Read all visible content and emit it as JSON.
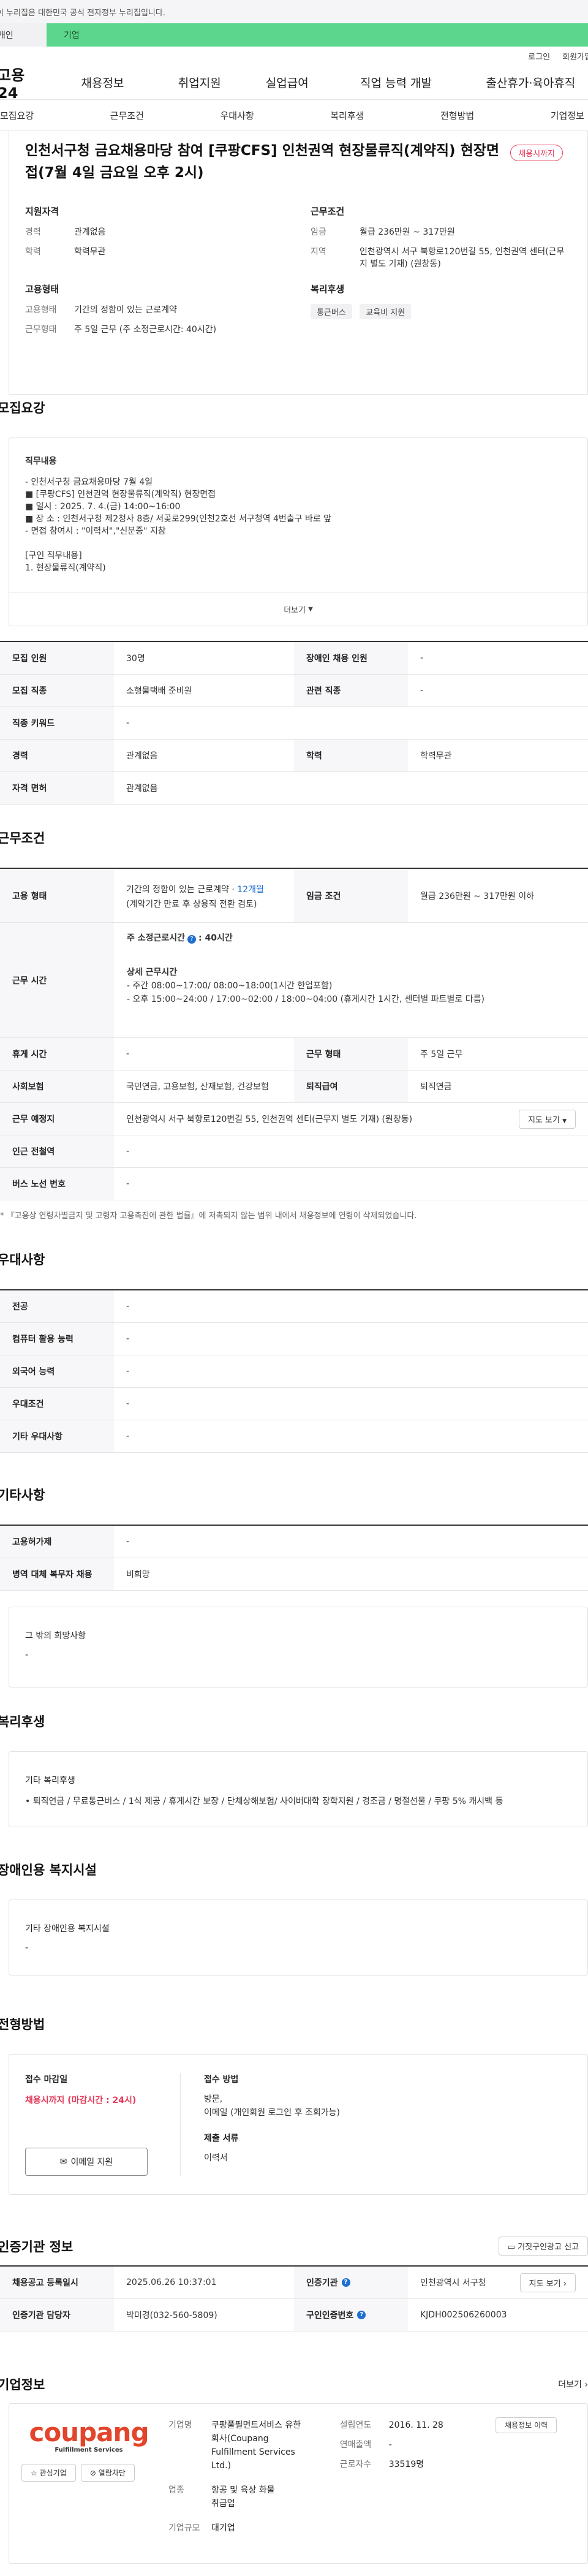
{
  "topbar": {
    "notice": "이 누리집은 대한민국 공식 전자정부 누리집입니다."
  },
  "site_tabs": {
    "personal": "개인",
    "enterprise": "기업"
  },
  "util": {
    "login": "로그인",
    "join": "회원가입"
  },
  "gnb": {
    "logo": "고용24",
    "menus": [
      "채용정보",
      "취업지원",
      "실업급여",
      "직업 능력 개발",
      "출산휴가·육아휴직"
    ]
  },
  "subnav": [
    "모집요강",
    "근무조건",
    "우대사항",
    "복리후생",
    "전형방법",
    "기업정보"
  ],
  "header": {
    "title": "인천서구청 금요채용마당 참여 [쿠팡CFS] 인천권역 현장물류직(계약직) 현장면접(7월 4일 금요일 오후 2시)",
    "badge": "채용시까지",
    "left_heading": "지원자격",
    "left": [
      {
        "k": "경력",
        "v": "관계없음"
      },
      {
        "k": "학력",
        "v": "학력무관"
      }
    ],
    "right_heading": "근무조건",
    "right": [
      {
        "k": "임금",
        "v": "월급 236만원 ~ 317만원"
      },
      {
        "k": "지역",
        "v": "인천광역시 서구 북항로120번길 55, 인천권역 센터(근무지 별도 기재) (원창동)"
      }
    ],
    "emp_heading": "고용형태",
    "emp": [
      {
        "k": "고용형태",
        "v": "기간의 정함이 있는 근로계약"
      },
      {
        "k": "근무형태",
        "v": "주 5일 근무 (주 소정근로시간: 40시간)"
      }
    ],
    "welfare_heading": "복리후생",
    "welfare": [
      "통근버스",
      "교육비 지원"
    ]
  },
  "recruit": {
    "title": "모집요강",
    "content_label": "직무내용",
    "lines": [
      "- 인천서구청 금요채용마당 7월 4일",
      "■ [쿠팡CFS] 인천권역 현장물류직(계약직) 현장면접",
      "■ 일시 : 2025. 7. 4.(금) 14:00~16:00",
      "■ 장 소 : 인천서구청 제2청사 8층/ 서곶로299(인천2호선 서구청역 4번출구 바로 앞",
      "- 면접 참여시 : \"이력서\",\"신분증\" 지참",
      "",
      "[구인 직무내용]",
      "1. 현장물류직(계약직)"
    ],
    "more": "더보기",
    "rows": [
      [
        {
          "k": "모집 인원",
          "v": "30명"
        },
        {
          "k": "장애인 채용 인원",
          "v": "-"
        }
      ],
      [
        {
          "k": "모집 직종",
          "v": "소형물택배 준비원"
        },
        {
          "k": "관련 직종",
          "v": "-"
        }
      ],
      [
        {
          "k": "직종 키워드",
          "v": "-"
        }
      ],
      [
        {
          "k": "경력",
          "v": "관계없음"
        },
        {
          "k": "학력",
          "v": "학력무관"
        }
      ],
      [
        {
          "k": "자격 면허",
          "v": "관계없음"
        }
      ]
    ]
  },
  "work": {
    "title": "근무조건",
    "emp_k": "고용 형태",
    "emp_v1": "기간의 정함이 있는 근로계약 · ",
    "emp_link": "12개월",
    "emp_v2": "(계약기간 만료 후 상용직 전환 검토)",
    "wage_k": "임금 조건",
    "wage_v": "월급 236만원 ~ 317만원 이하",
    "time_k": "근무 시간",
    "time_head": "주 소정근로시간",
    "time_hours": ": 40시간",
    "time_detail_head": "상세 근무시간",
    "time_lines": [
      "- 주간 08:00~17:00/ 08:00~18:00(1시간 한업포함)",
      "- 오후 15:00~24:00 / 17:00~02:00 / 18:00~04:00 (휴게시간 1시간, 센터별 파트별로 다름)"
    ],
    "rest_k": "휴게 시간",
    "rest_v": "-",
    "form_k": "근무 형태",
    "form_v": "주 5일 근무",
    "ins_k": "사회보험",
    "ins_v": "국민연금, 고용보험, 산재보험, 건강보험",
    "ret_k": "퇴직급여",
    "ret_v": "퇴직연금",
    "place_k": "근무 예정지",
    "place_v": "인천광역시 서구 북항로120번길 55, 인천권역 센터(근무지 별도 기재) (원창동)",
    "map_btn": "지도 보기",
    "sub_k": "인근 전철역",
    "sub_v": "-",
    "bus_k": "버스 노선 번호",
    "bus_v": "-",
    "note": "* 『고용상 연령차별금지 및 고령자 고용촉진에 관한 법률』에 저촉되지 않는 범위 내에서 채용정보에 연령이 삭제되었습니다."
  },
  "pref": {
    "title": "우대사항",
    "rows": [
      {
        "k": "전공",
        "v": "-"
      },
      {
        "k": "컴퓨터 활용 능력",
        "v": "-"
      },
      {
        "k": "외국어 능력",
        "v": "-"
      },
      {
        "k": "우대조건",
        "v": "-"
      },
      {
        "k": "기타 우대사항",
        "v": "-"
      }
    ]
  },
  "etc": {
    "title": "기타사항",
    "rows": [
      {
        "k": "고용허가제",
        "v": "-"
      },
      {
        "k": "병역 대체 복무자 채용",
        "v": "비희망"
      }
    ],
    "hope_label": "그 밖의 희망사항",
    "hope_v": "-"
  },
  "welfare": {
    "title": "복리후생",
    "label": "기타 복리후생",
    "text": "• 퇴직연금 / 무료통근버스 / 1식 제공 / 휴게시간 보장 / 단체상해보험/ 사이버대학 장학지원 / 경조금 / 명절선물 / 쿠팡 5% 캐시백 등"
  },
  "disab": {
    "title": "장애인용 복지시설",
    "label": "기타 장애인용 복지시설",
    "v": "-"
  },
  "selection": {
    "title": "전형방법",
    "deadline_label": "접수 마감일",
    "deadline_v": "채용시까지 (마감시간 : 24시)",
    "apply_btn": "이메일 지원",
    "method_label": "접수 방법",
    "method_v1": "방문,",
    "method_v2": "이메일 (개인회원 로그인 후 조회가능)",
    "docs_label": "제출 서류",
    "docs_v": "이력서"
  },
  "cert": {
    "title": "인증기관 정보",
    "report_btn": "거짓구인광고 신고",
    "reg_k": "채용공고 등록일시",
    "reg_v": "2025.06.26 10:37:01",
    "org_k": "인증기관",
    "org_v": "인천광역시 서구청",
    "map_btn": "지도 보기",
    "mgr_k": "인증기관 담당자",
    "mgr_v": "박미경(032-560-5809)",
    "no_k": "구인인증번호",
    "no_v": "KJDH002506260003"
  },
  "company": {
    "title": "기업정보",
    "more": "더보기",
    "logo_main": "coupang",
    "logo_sub": "Fulfillment Services",
    "interest_btn": "관심기업",
    "block_btn": "열람차단",
    "name_k": "기업명",
    "name_v": "쿠팡풀필먼트서비스 유한회사(Coupang Fulfillment Services Ltd.)",
    "year_k": "설립연도",
    "year_v": "2016. 11. 28",
    "sales_k": "연매출액",
    "sales_v": "-",
    "emp_k": "근로자수",
    "emp_v": "33519명",
    "ind_k": "업종",
    "ind_v": "항공 및 육상 화물 취급업",
    "size_k": "기업규모",
    "size_v": "대기업",
    "jobs_btn": "채용정보 이력"
  },
  "colors": {
    "green": "#5cd68c",
    "pink": "#e23b5a",
    "blue": "#1f6fd1"
  }
}
